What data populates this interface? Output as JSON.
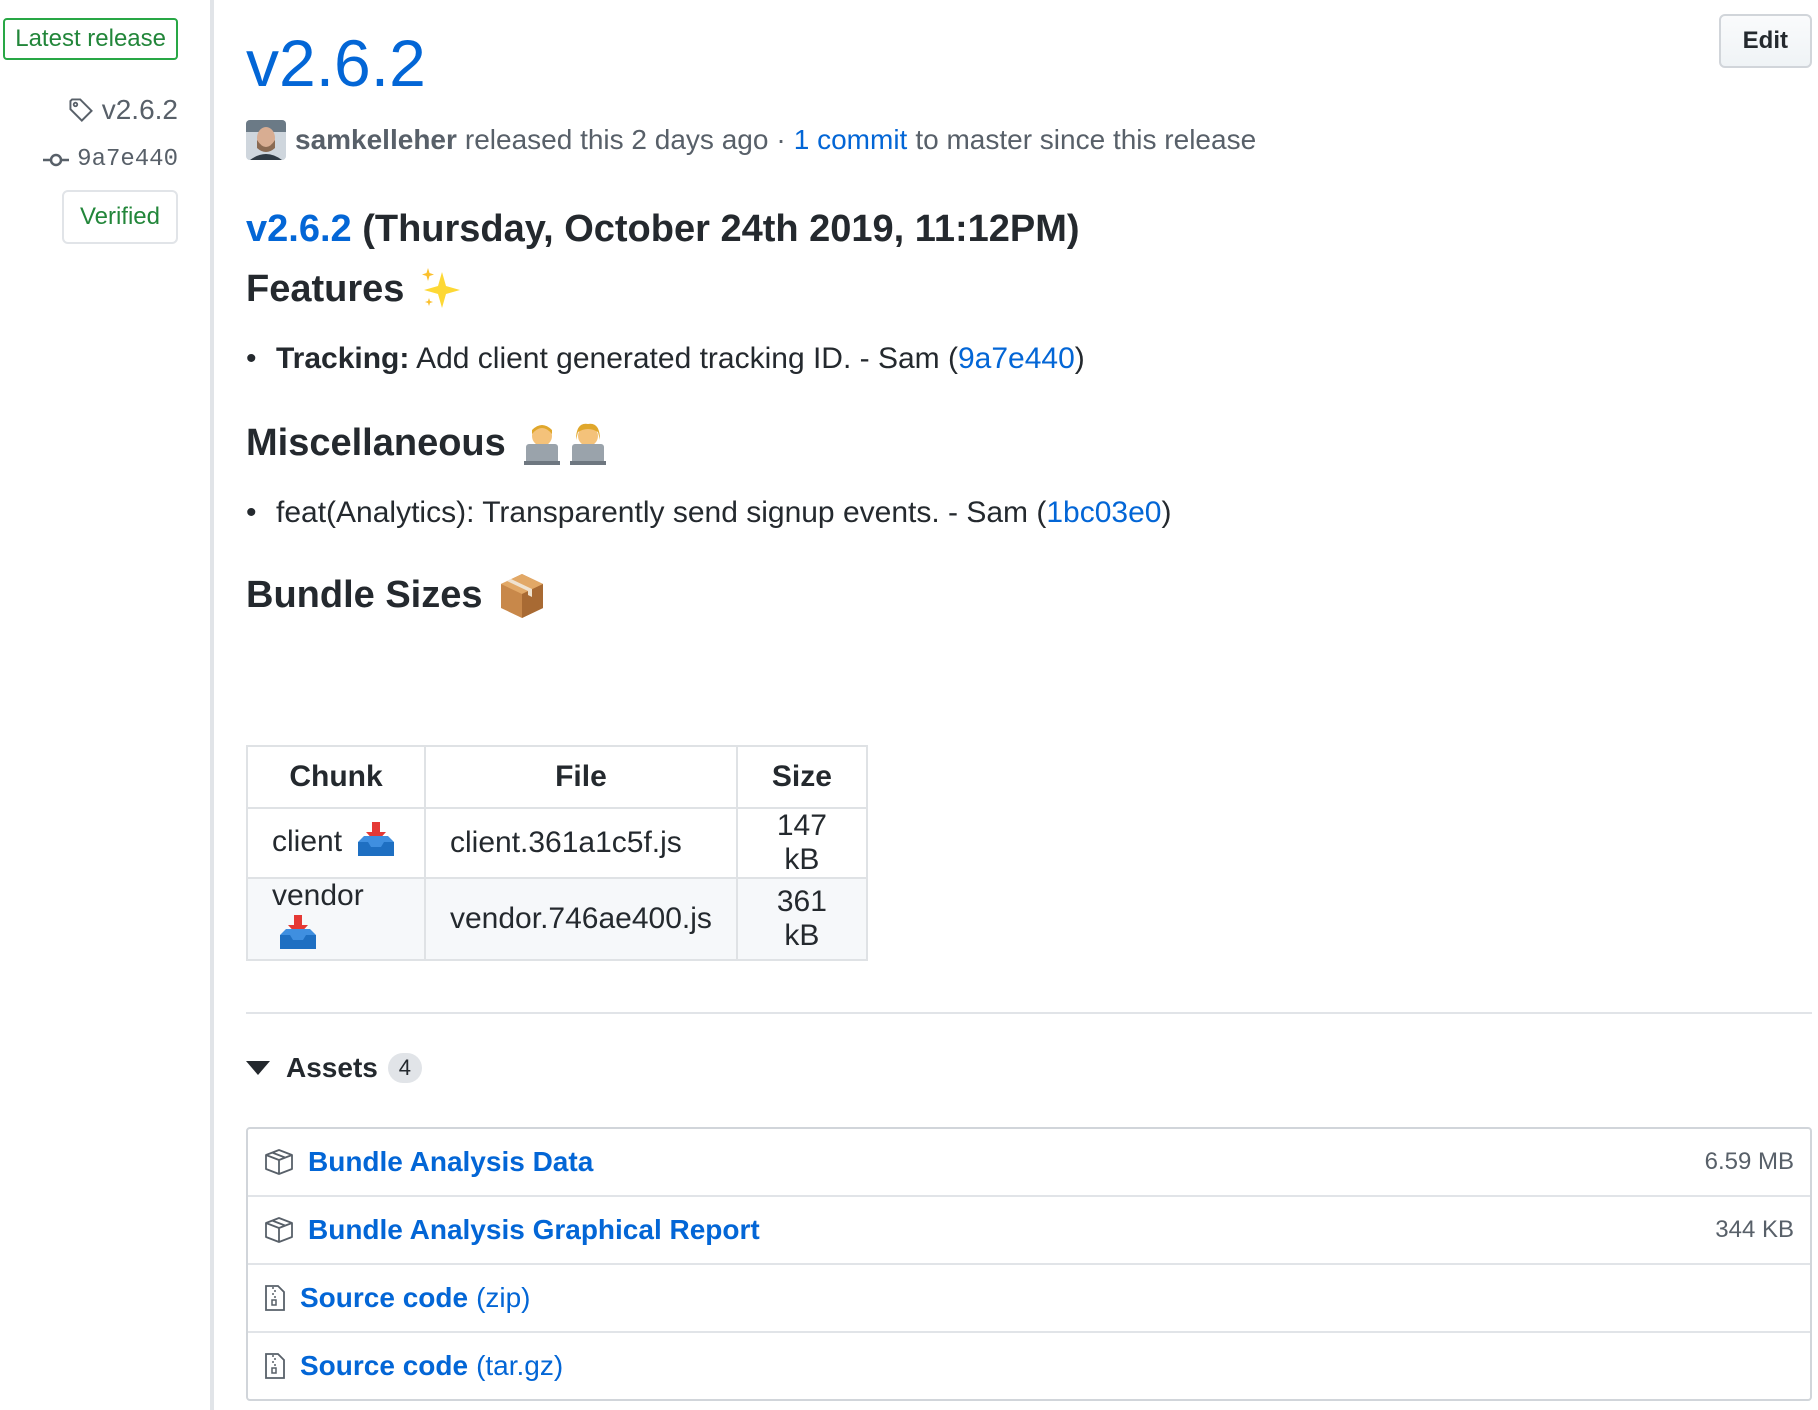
{
  "sidebar": {
    "latest_label": "Latest release",
    "tag": "v2.6.2",
    "commit": "9a7e440",
    "verified": "Verified"
  },
  "header": {
    "edit_label": "Edit",
    "title": "v2.6.2",
    "author": "samkelleher",
    "released_text": "released this 2 days ago",
    "separator": "·",
    "commits_link": "1 commit",
    "commits_suffix": "to master since this release"
  },
  "notes": {
    "heading_link": "v2.6.2",
    "heading_date": "(Thursday, October 24th 2019, 11:12PM)",
    "features": {
      "title": "Features",
      "emoji": "✨",
      "items": [
        {
          "bold": "Tracking:",
          "text": "Add client generated tracking ID. - Sam (",
          "hash": "9a7e440",
          "close": ")"
        }
      ]
    },
    "misc": {
      "title": "Miscellaneous",
      "emoji": "👨‍💻👩‍💻",
      "items": [
        {
          "text": "feat(Analytics): Transparently send signup events. - Sam (",
          "hash": "1bc03e0",
          "close": ")"
        }
      ]
    },
    "bundle": {
      "title": "Bundle Sizes",
      "emoji": "📦",
      "headers": [
        "Chunk",
        "File",
        "Size"
      ],
      "rows": [
        {
          "chunk": "client",
          "icon": "inbox-tray-icon",
          "file": "client.361a1c5f.js",
          "size": "147 kB"
        },
        {
          "chunk": "vendor",
          "icon": "inbox-tray-icon",
          "file": "vendor.746ae400.js",
          "size": "361 kB"
        }
      ]
    }
  },
  "assets": {
    "label": "Assets",
    "count": "4",
    "items": [
      {
        "icon": "package-icon",
        "name": "Bundle Analysis Data",
        "ext": "",
        "size": "6.59 MB"
      },
      {
        "icon": "package-icon",
        "name": "Bundle Analysis Graphical Report",
        "ext": "",
        "size": "344 KB"
      },
      {
        "icon": "file-zip-icon",
        "name": "Source code",
        "ext": "(zip)",
        "size": ""
      },
      {
        "icon": "file-zip-icon",
        "name": "Source code",
        "ext": "(tar.gz)",
        "size": ""
      }
    ]
  },
  "colors": {
    "link": "#0366d6",
    "verified_green": "#22863a",
    "latest_border": "#28a745",
    "text": "#24292e",
    "muted": "#586069"
  }
}
